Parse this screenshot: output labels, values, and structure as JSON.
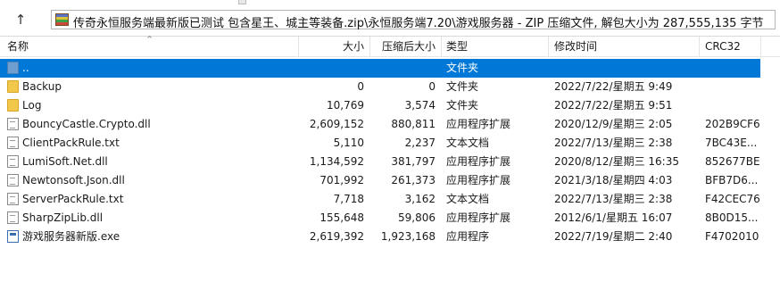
{
  "path": {
    "up_icon": "arrow-up-icon",
    "archive_icon": "winrar-archive-icon",
    "text": "传奇永恒服务端最新版已测试 包含星王、城主等装备.zip\\永恒服务端7.20\\游戏服务器 - ZIP 压缩文件, 解包大小为 287,555,135 字节"
  },
  "columns": {
    "name": "名称",
    "size": "大小",
    "packed": "压缩后大小",
    "type": "类型",
    "modified": "修改时间",
    "crc": "CRC32"
  },
  "files": [
    {
      "name": "..",
      "size": "",
      "packed": "",
      "type": "文件夹",
      "modified": "",
      "crc": "",
      "icon": "parent-folder-icon",
      "selected": true
    },
    {
      "name": "Backup",
      "size": "0",
      "packed": "0",
      "type": "文件夹",
      "modified": "2022/7/22/星期五 9:49",
      "crc": "",
      "icon": "folder-icon"
    },
    {
      "name": "Log",
      "size": "10,769",
      "packed": "3,574",
      "type": "文件夹",
      "modified": "2022/7/22/星期五 9:51",
      "crc": "",
      "icon": "folder-icon"
    },
    {
      "name": "BouncyCastle.Crypto.dll",
      "size": "2,609,152",
      "packed": "880,811",
      "type": "应用程序扩展",
      "modified": "2020/12/9/星期三 2:05",
      "crc": "202B9CF6",
      "icon": "dll-file-icon"
    },
    {
      "name": "ClientPackRule.txt",
      "size": "5,110",
      "packed": "2,237",
      "type": "文本文档",
      "modified": "2022/7/13/星期三 2:38",
      "crc": "7BC43E...",
      "icon": "text-file-icon"
    },
    {
      "name": "LumiSoft.Net.dll",
      "size": "1,134,592",
      "packed": "381,797",
      "type": "应用程序扩展",
      "modified": "2020/8/12/星期三 16:35",
      "crc": "852677BE",
      "icon": "dll-file-icon"
    },
    {
      "name": "Newtonsoft.Json.dll",
      "size": "701,992",
      "packed": "261,373",
      "type": "应用程序扩展",
      "modified": "2021/3/18/星期四 4:03",
      "crc": "BFB7D6...",
      "icon": "dll-file-icon"
    },
    {
      "name": "ServerPackRule.txt",
      "size": "7,718",
      "packed": "3,162",
      "type": "文本文档",
      "modified": "2022/7/13/星期三 2:38",
      "crc": "F42CEC76",
      "icon": "text-file-icon"
    },
    {
      "name": "SharpZipLib.dll",
      "size": "155,648",
      "packed": "59,806",
      "type": "应用程序扩展",
      "modified": "2012/6/1/星期五 16:07",
      "crc": "8B0D15...",
      "icon": "dll-file-icon"
    },
    {
      "name": "游戏服务器新版.exe",
      "size": "2,619,392",
      "packed": "1,923,168",
      "type": "应用程序",
      "modified": "2022/7/19/星期二 2:40",
      "crc": "F4702010",
      "icon": "exe-file-icon"
    }
  ]
}
